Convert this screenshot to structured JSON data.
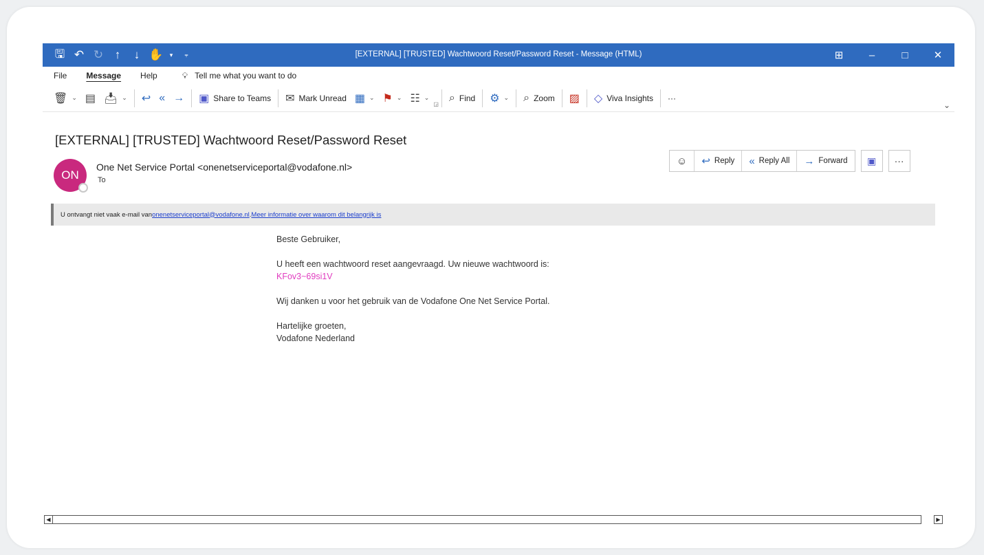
{
  "window": {
    "title": "[EXTERNAL] [TRUSTED] Wachtwoord Reset/Password Reset  -  Message (HTML)",
    "titlebar_color": "#2f6bbf",
    "quick_access_icons": [
      "save-icon",
      "undo-icon",
      "redo-icon",
      "up-arrow-icon",
      "down-arrow-icon",
      "touch-mode-icon",
      "customize-icon"
    ]
  },
  "menu": {
    "items": [
      "File",
      "Message",
      "Help"
    ],
    "active": "Message",
    "tell_me": "Tell me what you want to do"
  },
  "ribbon": {
    "share_to_teams": "Share to Teams",
    "mark_unread": "Mark Unread",
    "find": "Find",
    "zoom": "Zoom",
    "viva_insights": "Viva Insights",
    "more": "···"
  },
  "message": {
    "subject": "[EXTERNAL] [TRUSTED] Wachtwoord Reset/Password Reset",
    "avatar_initials": "ON",
    "avatar_color": "#c9297e",
    "sender": "One Net Service Portal <onenetserviceportal@vodafone.nl>",
    "to_label": "To",
    "actions": {
      "reply": "Reply",
      "reply_all": "Reply All",
      "forward": "Forward",
      "more": "···"
    },
    "infobar": {
      "prefix": "U ontvangt niet vaak e-mail van ",
      "email_link": "onenetserviceportal@vodafone.nl",
      "separator": ". ",
      "info_link": "Meer informatie over waarom dit belangrijk is"
    },
    "body": {
      "greeting": "Beste Gebruiker,",
      "line1": "U heeft een wachtwoord reset aangevraagd. Uw nieuwe wachtwoord is:",
      "password": "KFov3~69si1V",
      "password_color": "#e03bbf",
      "line2": "Wij danken u voor het gebruik van de Vodafone One Net Service Portal.",
      "closing": "Hartelijke groeten,",
      "signature": "Vodafone Nederland"
    }
  }
}
